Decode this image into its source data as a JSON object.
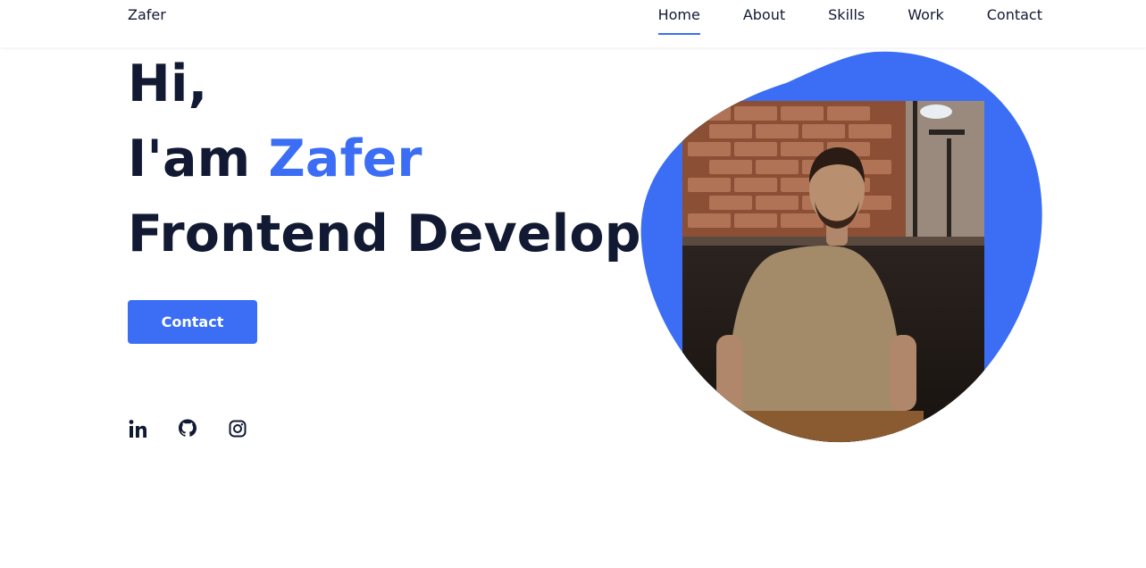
{
  "header": {
    "logo": "Zafer",
    "nav": [
      {
        "label": "Home",
        "active": true
      },
      {
        "label": "About",
        "active": false
      },
      {
        "label": "Skills",
        "active": false
      },
      {
        "label": "Work",
        "active": false
      },
      {
        "label": "Contact",
        "active": false
      }
    ]
  },
  "hero": {
    "greeting": "Hi,",
    "intro_prefix": "I'am",
    "name": "Zafer",
    "role": "Frontend Developer",
    "cta_label": "Contact",
    "portrait": "portrait-photo"
  },
  "socials": [
    {
      "icon": "linkedin-icon"
    },
    {
      "icon": "github-icon"
    },
    {
      "icon": "instagram-icon"
    }
  ],
  "colors": {
    "accent": "#3b6ef5",
    "text": "#121a33",
    "background": "#ffffff"
  }
}
